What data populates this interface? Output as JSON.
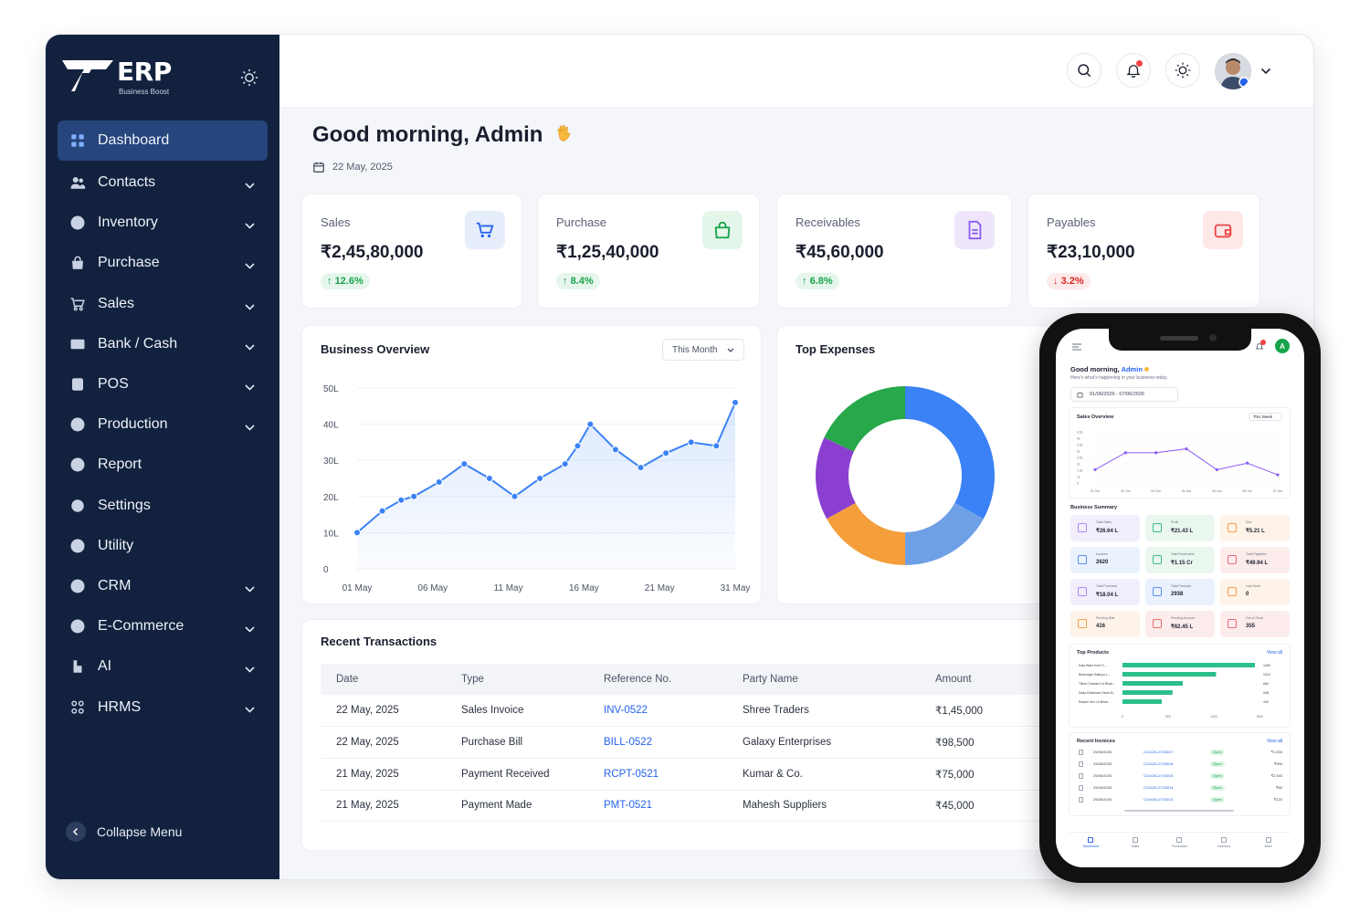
{
  "app": {
    "logo_text": "ERP",
    "logo_sub": "Business Boost"
  },
  "sidebar": {
    "items": [
      {
        "label": "Dashboard",
        "icon": "grid-icon",
        "active": true,
        "expandable": false
      },
      {
        "label": "Contacts",
        "icon": "users-icon",
        "expandable": true
      },
      {
        "label": "Inventory",
        "icon": "box-icon",
        "expandable": true
      },
      {
        "label": "Purchase",
        "icon": "bag-icon",
        "expandable": true
      },
      {
        "label": "Sales",
        "icon": "cart-icon",
        "expandable": true
      },
      {
        "label": "Bank / Cash",
        "icon": "bank-card-icon",
        "expandable": true
      },
      {
        "label": "POS",
        "icon": "pos-icon",
        "expandable": true
      },
      {
        "label": "Production",
        "icon": "production-icon",
        "expandable": true
      },
      {
        "label": "Report",
        "icon": "report-icon",
        "expandable": false
      },
      {
        "label": "Settings",
        "icon": "gear-icon",
        "expandable": false
      },
      {
        "label": "Utility",
        "icon": "utility-icon",
        "expandable": false
      },
      {
        "label": "CRM",
        "icon": "crm-icon",
        "expandable": true
      },
      {
        "label": "E-Commerce",
        "icon": "ecommerce-icon",
        "expandable": true
      },
      {
        "label": "AI",
        "icon": "ai-icon",
        "expandable": true
      },
      {
        "label": "HRMS",
        "icon": "hrms-icon",
        "expandable": true
      }
    ],
    "collapse_label": "Collapse Menu"
  },
  "header": {
    "greeting": "Good morning, Admin",
    "date": "22 May, 2025",
    "notification_dot_color": "#ef4444"
  },
  "stats": [
    {
      "label": "Sales",
      "value": "₹2,45,80,000",
      "change": "12.6%",
      "direction": "up",
      "icon": "cart-icon",
      "icon_bg": "#e6eefc",
      "icon_color": "#2563eb"
    },
    {
      "label": "Purchase",
      "value": "₹1,25,40,000",
      "change": "8.4%",
      "direction": "up",
      "icon": "bag-icon",
      "icon_bg": "#e4f6ea",
      "icon_color": "#16a34a"
    },
    {
      "label": "Receivables",
      "value": "₹45,60,000",
      "change": "6.8%",
      "direction": "up",
      "icon": "document-icon",
      "icon_bg": "#efe6fb",
      "icon_color": "#8b5cf6"
    },
    {
      "label": "Payables",
      "value": "₹23,10,000",
      "change": "3.2%",
      "direction": "down",
      "icon": "wallet-icon",
      "icon_bg": "#fde7e7",
      "icon_color": "#ef4444"
    }
  ],
  "overview": {
    "title": "Business Overview",
    "period": "This Month",
    "chart_data": {
      "type": "line",
      "x_ticks": [
        "01 May",
        "06 May",
        "11 May",
        "16 May",
        "21 May",
        "31 May"
      ],
      "y_ticks": [
        "0",
        "10L",
        "20L",
        "30L",
        "40L",
        "50L"
      ],
      "ylim": [
        0,
        50
      ],
      "x_range": [
        1,
        31
      ],
      "x": [
        1,
        3,
        4.5,
        5.5,
        7.5,
        9.5,
        11.5,
        13.5,
        15.5,
        17.5,
        18.5,
        19.5,
        21.5,
        23.5,
        25.5,
        27.5,
        29.5,
        31
      ],
      "values": [
        10,
        16,
        19,
        20,
        24,
        29,
        25,
        20,
        25,
        29,
        34,
        40,
        33,
        28,
        32,
        35,
        34,
        46
      ],
      "color": "#3b82f6"
    }
  },
  "expenses": {
    "title": "Top Expenses",
    "chart_data": {
      "type": "pie",
      "values": [
        33,
        17,
        17,
        15,
        18
      ],
      "colors": [
        "#3b82f6",
        "#6ea0e6",
        "#f59e3c",
        "#8b3fd1",
        "#27a84a"
      ]
    }
  },
  "transactions": {
    "title": "Recent Transactions",
    "columns": [
      "Date",
      "Type",
      "Reference No.",
      "Party Name",
      "Amount"
    ],
    "rows": [
      [
        "22 May, 2025",
        "Sales Invoice",
        "INV-0522",
        "Shree Traders",
        "₹1,45,000"
      ],
      [
        "22 May, 2025",
        "Purchase Bill",
        "BILL-0522",
        "Galaxy Enterprises",
        "₹98,500"
      ],
      [
        "21 May, 2025",
        "Payment Received",
        "RCPT-0521",
        "Kumar & Co.",
        "₹75,000"
      ],
      [
        "21 May, 2025",
        "Payment Made",
        "PMT-0521",
        "Mahesh Suppliers",
        "₹45,000"
      ]
    ]
  },
  "phone": {
    "greeting_prefix": "Good morning,",
    "greeting_name": "Admin",
    "subtext": "Here's what's happening in your business today.",
    "date_range": "01/06/2026  -  07/06/2026",
    "avatar_letter": "A",
    "sales_overview": {
      "title": "Sales Overview",
      "period": "This Week",
      "chart_data": {
        "type": "line",
        "x_ticks": [
          "01 Jun",
          "02 Jun",
          "03 Jun",
          "04 Jun",
          "05 Jun",
          "06 Jun",
          "07 Jun"
        ],
        "y_ticks": [
          "0",
          "1L",
          "1.5L",
          "2L",
          "2.5L",
          "3L",
          "3.5L",
          "4L",
          "4.5L"
        ],
        "values": [
          1.6,
          2.9,
          2.9,
          3.2,
          1.6,
          2.1,
          1.2
        ],
        "color": "#8b5cf6"
      }
    },
    "summary_title": "Business Summary",
    "summary": [
      {
        "label": "Total Sales",
        "value": "₹26.64 L",
        "bg": "#f3eefc",
        "ic": "#a78bfa"
      },
      {
        "label": "Profit",
        "value": "₹21.43 L",
        "bg": "#eaf7ef",
        "ic": "#34c07a"
      },
      {
        "label": "Due",
        "value": "₹5.21 L",
        "bg": "#fdf3e8",
        "ic": "#f5a04a"
      },
      {
        "label": "Invoices",
        "value": "2620",
        "bg": "#eaf2fd",
        "ic": "#5b8def"
      },
      {
        "label": "Total Receivable",
        "value": "₹1.15 Cr",
        "bg": "#eaf7ef",
        "ic": "#34c07a"
      },
      {
        "label": "Total Payables",
        "value": "₹49.94 L",
        "bg": "#fdecec",
        "ic": "#ef6b6b"
      },
      {
        "label": "Total Purchase",
        "value": "₹18.04 L",
        "bg": "#f3eefc",
        "ic": "#a78bfa"
      },
      {
        "label": "Total Products",
        "value": "2938",
        "bg": "#eaf2fd",
        "ic": "#5b8def"
      },
      {
        "label": "Low Stock",
        "value": "0",
        "bg": "#fdf3e8",
        "ic": "#f5a04a"
      },
      {
        "label": "Pending Bills",
        "value": "416",
        "bg": "#fdf3e8",
        "ic": "#f5a04a"
      },
      {
        "label": "Pending Amount",
        "value": "₹62.45 L",
        "bg": "#fdecec",
        "ic": "#ef6b6b"
      },
      {
        "label": "Out of Stock",
        "value": "355",
        "bg": "#fdecec",
        "ic": "#ef6b6b"
      }
    ],
    "top_products": {
      "title": "Top Products",
      "view_all": "View all",
      "chart_data": {
        "type": "bar",
        "categories": [
          "Kala Wala Kurti G...",
          "Bhavnagri Gathiya L...",
          "Tikha Chavanu Lit Bhan...",
          "Sada Khakhara Hand M...",
          "Rolanh Sev Lit Bhan..."
        ],
        "values": [
          1450,
          1024,
          660,
          548,
          430
        ],
        "x_ticks": [
          "0",
          "500",
          "1000",
          "1500"
        ],
        "xlim": [
          0,
          1500
        ]
      }
    },
    "recent_invoices": {
      "title": "Recent Invoices",
      "view_all": "View all",
      "rows": [
        {
          "date": "29/06/2026",
          "ref": "COU/26-27/33017",
          "status": "Open",
          "amount": "₹1,000"
        },
        {
          "date": "29/06/2026",
          "ref": "COU/26-27/33016",
          "status": "Open",
          "amount": "₹900"
        },
        {
          "date": "29/06/2026",
          "ref": "COU/26-27/33015",
          "status": "Open",
          "amount": "₹2,340"
        },
        {
          "date": "29/06/2026",
          "ref": "COU/26-27/33014",
          "status": "Open",
          "amount": "₹80"
        },
        {
          "date": "29/06/2026",
          "ref": "COU/26-27/33013",
          "status": "Open",
          "amount": "₹120"
        }
      ]
    },
    "bottom_nav": [
      "Dashboard",
      "Sales",
      "Purchases",
      "Inventory",
      "More"
    ]
  }
}
